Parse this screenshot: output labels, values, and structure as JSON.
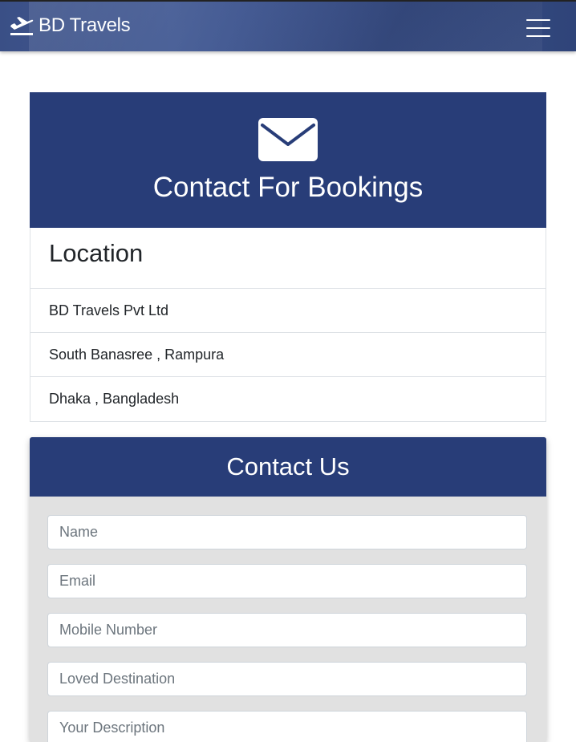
{
  "navbar": {
    "brand": "BD Travels",
    "brand_icon": "plane-icon",
    "menu_icon": "hamburger-icon"
  },
  "booking": {
    "icon": "envelope-icon",
    "title": "Contact For Bookings"
  },
  "location": {
    "heading": "Location",
    "items": [
      "BD Travels Pvt Ltd",
      "South Banasree , Rampura",
      "Dhaka , Bangladesh"
    ]
  },
  "contact": {
    "title": "Contact Us",
    "fields": {
      "name": "Name",
      "email": "Email",
      "mobile": "Mobile Number",
      "destination": "Loved Destination",
      "description": "Your Description"
    }
  },
  "colors": {
    "primary": "#283d78",
    "card_bg": "#e1e1e1",
    "navbar": "#3c528c"
  }
}
